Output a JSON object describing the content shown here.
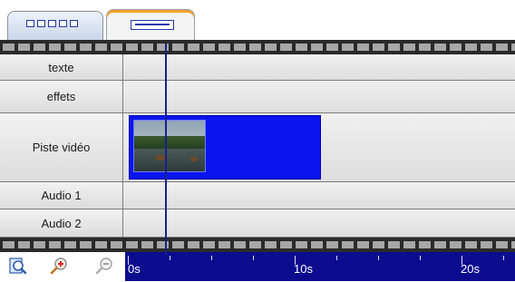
{
  "tracks": [
    {
      "label": "texte"
    },
    {
      "label": "effets"
    },
    {
      "label": "Piste vidéo"
    },
    {
      "label": "Audio 1"
    },
    {
      "label": "Audio 2"
    }
  ],
  "ruler": {
    "labels": [
      "0s",
      "10s",
      "20s"
    ]
  },
  "clip": {
    "track": "Piste vidéo",
    "start_s": 0,
    "end_s": 11.6
  },
  "playhead_time_s": 2.3,
  "icons": {
    "zoom_fit": "zoom-fit-icon",
    "zoom_in": "zoom-in-icon",
    "zoom_out": "zoom-out-icon"
  },
  "colors": {
    "clip": "#0a14ee",
    "ruler": "#0c0c8e",
    "playhead": "#16218a",
    "active_tab_accent": "#f2a12a"
  }
}
